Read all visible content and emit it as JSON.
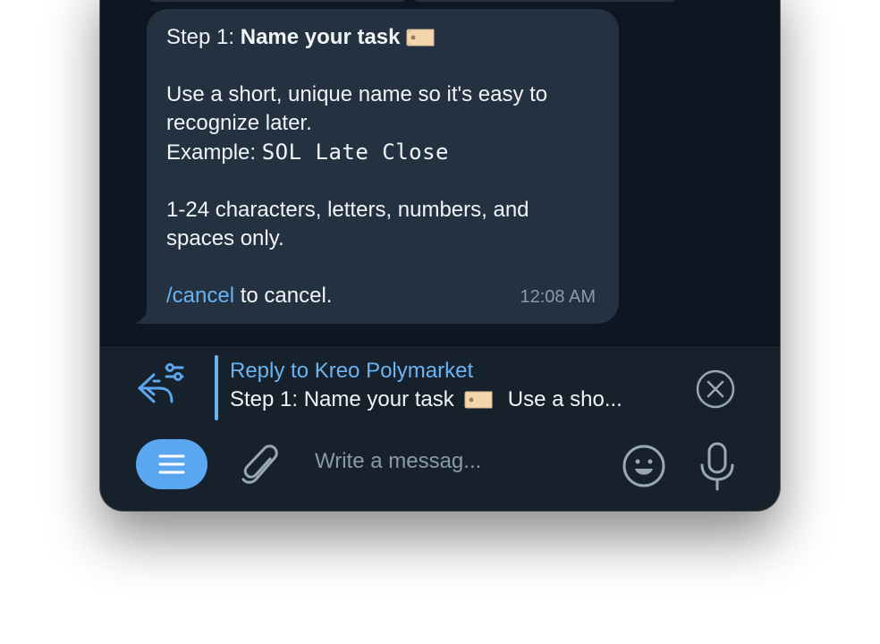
{
  "message": {
    "step_prefix": "Step 1: ",
    "step_title": "Name your task",
    "step_emoji_icon": "label-tag-icon",
    "line1": "Use a short, unique name so it's easy to",
    "line2": "recognize later.",
    "example_label": "Example: ",
    "example_value": "SOL Late Close",
    "rules_line1": "1-24 characters, letters, numbers, and",
    "rules_line2": "spaces only.",
    "cancel_command": "/cancel",
    "cancel_suffix": " to cancel.",
    "time": "12:08 AM"
  },
  "reply": {
    "icon": "reply-settings-icon",
    "title": "Reply to Kreo Polymarket",
    "preview_start": "Step 1: Name your task",
    "preview_end": "Use a sho...",
    "close_icon": "close-circle-icon"
  },
  "composer": {
    "placeholder": "Write a messag...",
    "menu_icon": "menu-icon",
    "attach_icon": "paperclip-icon",
    "emoji_icon": "smiley-icon",
    "mic_icon": "microphone-icon"
  },
  "colors": {
    "window_bg": "#17212b",
    "chat_bg": "#0e1621",
    "bubble_bg": "#243140",
    "accent": "#6ab3f3",
    "menu_button": "#5aa7f0",
    "text": "#f1f4f7",
    "muted": "#8a9aab"
  }
}
